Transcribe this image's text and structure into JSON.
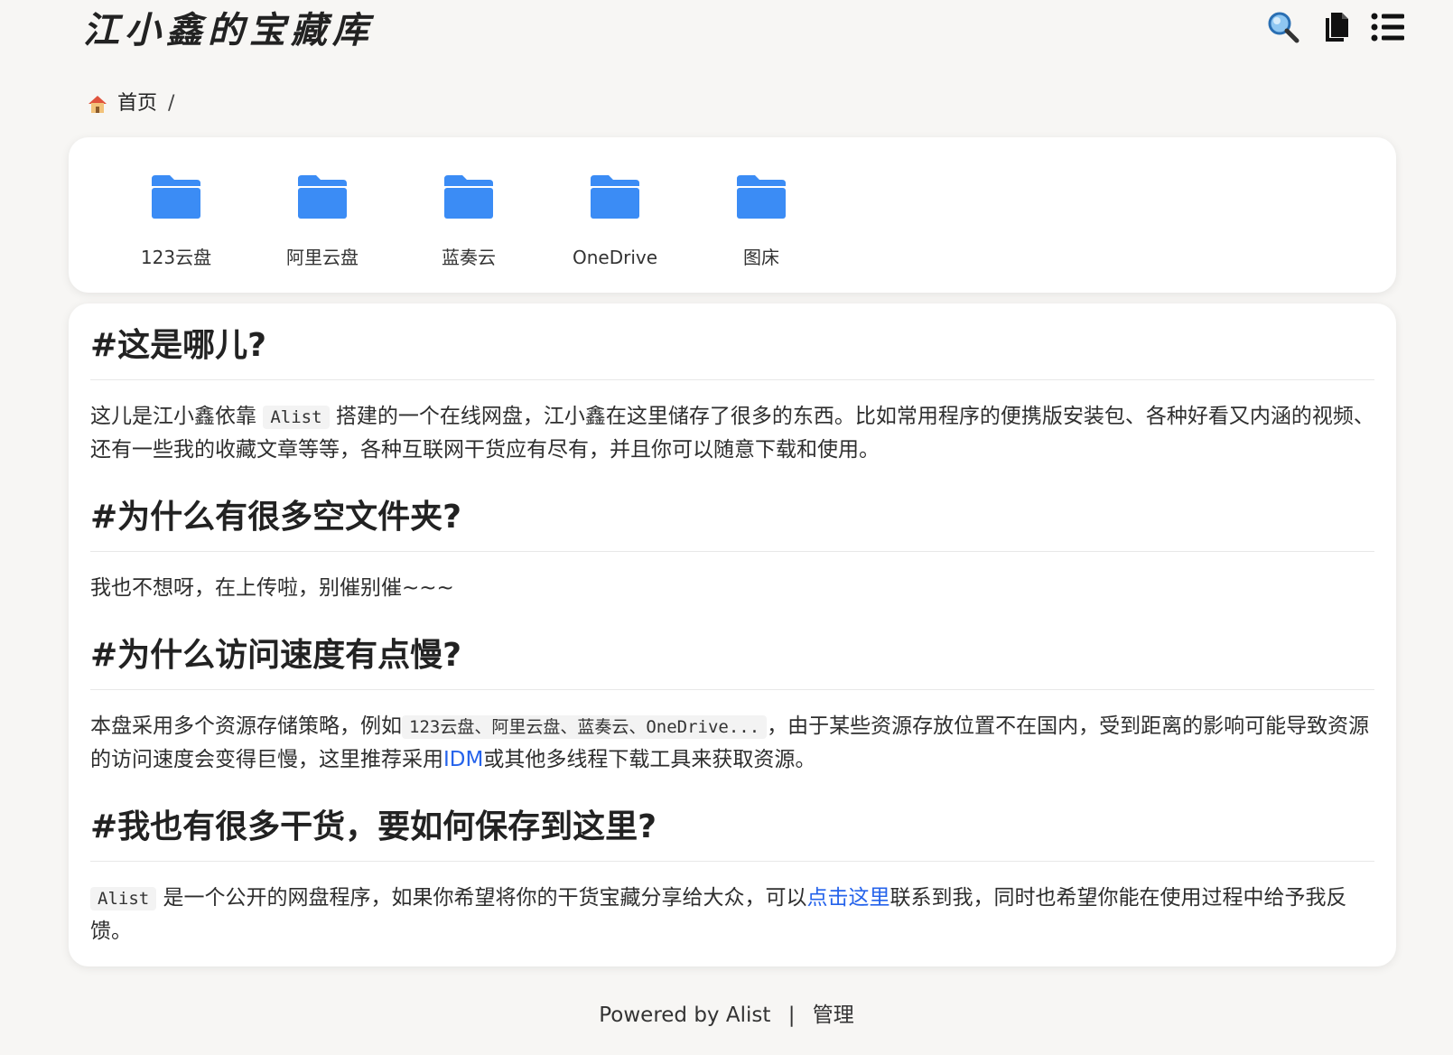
{
  "header": {
    "logo_text": "江小鑫的宝藏库",
    "icons": [
      "search-icon",
      "copy-icon",
      "list-icon"
    ]
  },
  "breadcrumb": {
    "home_label": "首页",
    "separator": "/"
  },
  "folders": [
    {
      "name": "123云盘"
    },
    {
      "name": "阿里云盘"
    },
    {
      "name": "蓝奏云"
    },
    {
      "name": "OneDrive"
    },
    {
      "name": "图床"
    }
  ],
  "readme": {
    "s1": {
      "title": "#这是哪儿?",
      "t1": "这儿是江小鑫依靠",
      "code": "Alist",
      "t2": "搭建的一个在线网盘，江小鑫在这里储存了很多的东西。比如常用程序的便携版安装包、各种好看又内涵的视频、还有一些我的收藏文章等等，各种互联网干货应有尽有，并且你可以随意下载和使用。"
    },
    "s2": {
      "title": "#为什么有很多空文件夹?",
      "t1": "我也不想呀，在上传啦，别催别催~~~"
    },
    "s3": {
      "title": "#为什么访问速度有点慢?",
      "t1": "本盘采用多个资源存储策略，例如",
      "code": "123云盘、阿里云盘、蓝奏云、OneDrive...",
      "t2": "，由于某些资源存放位置不在国内，受到距离的影响可能导致资源的访问速度会变得巨慢，这里推荐采用",
      "link": "IDM",
      "t3": "或其他多线程下载工具来获取资源。"
    },
    "s4": {
      "title": "#我也有很多干货，要如何保存到这里?",
      "code": "Alist",
      "t1": "是一个公开的网盘程序，如果你希望将你的干货宝藏分享给大众，可以",
      "link": "点击这里",
      "t2": "联系到我，同时也希望你能在使用过程中给予我反馈。"
    }
  },
  "footer": {
    "powered": "Powered by Alist",
    "separator": "|",
    "admin": "管理"
  },
  "colors": {
    "accent": "#2563eb",
    "folder": "#3b8cf5",
    "logo_underline": "#f5c542"
  }
}
